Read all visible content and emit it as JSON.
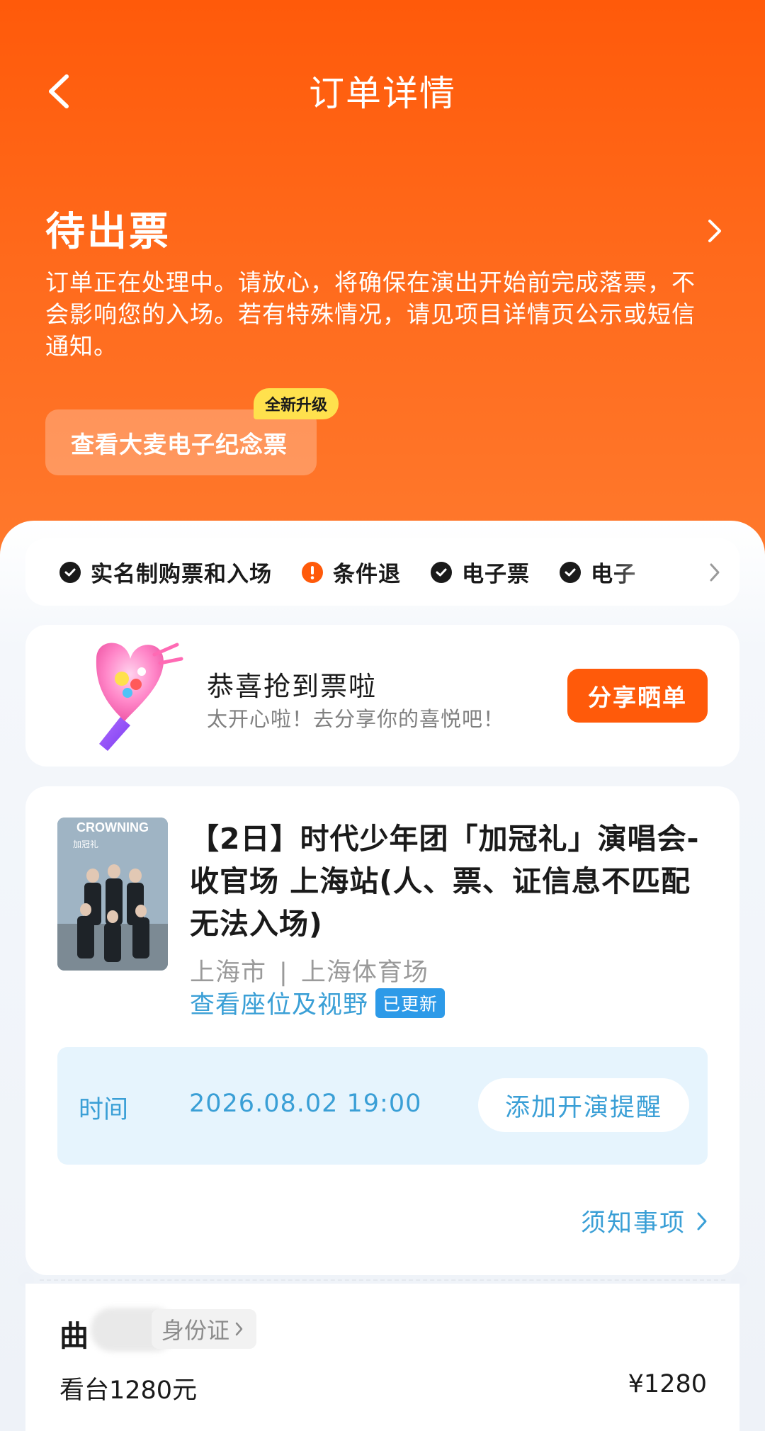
{
  "header": {
    "title": "订单详情"
  },
  "status": {
    "title": "待出票",
    "description": "订单正在处理中。请放心，将确保在演出开始前完成落票，不会影响您的入场。若有特殊情况，请见项目详情页公示或短信通知。",
    "souvenir_button": "查看大麦电子纪念票",
    "new_badge": "全新升级"
  },
  "features": [
    {
      "label": "实名制购票和入场",
      "icon": "check-icon"
    },
    {
      "label": "条件退",
      "icon": "exclamation-icon"
    },
    {
      "label": "电子票",
      "icon": "check-icon"
    },
    {
      "label": "电子",
      "icon": "check-icon"
    }
  ],
  "share": {
    "title": "恭喜抢到票啦",
    "subtitle": "太开心啦！去分享你的喜悦吧！",
    "button": "分享晒单"
  },
  "event": {
    "poster_text": "CROWNING",
    "poster_subtext": "加冠礼",
    "title": "【2日】时代少年团「加冠礼」演唱会-收官场 上海站(人、票、证信息不匹配无法入场)",
    "city": "上海市",
    "separator": "|",
    "venue": "上海体育场",
    "seat_link": "查看座位及视野",
    "updated_badge": "已更新",
    "time_label": "时间",
    "time_value": "2026.08.02 19:00",
    "reminder_button": "添加开演提醒",
    "notice_link": "须知事项"
  },
  "ticket": {
    "holder_surname": "曲",
    "id_type": "身份证",
    "ticket_type": "看台1280元",
    "price": "¥1280"
  },
  "colors": {
    "brand_orange": "#ff5a0a",
    "link_blue": "#3a9fd6",
    "badge_yellow": "#ffe14d"
  }
}
